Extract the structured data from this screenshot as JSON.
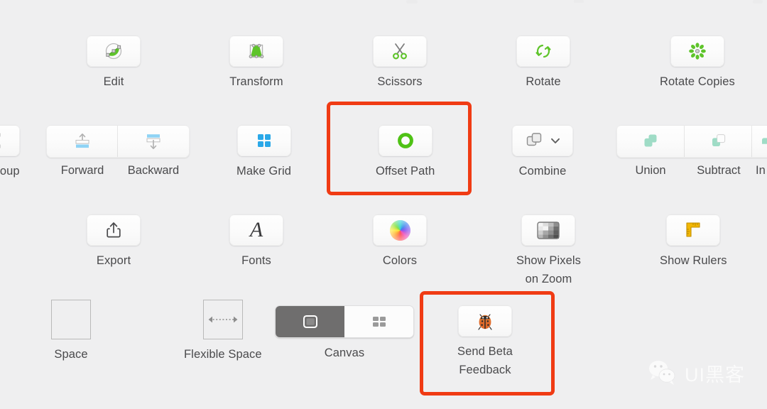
{
  "window": {
    "background_color": "#efeff0",
    "context": "macOS toolbar customization sheet"
  },
  "colors": {
    "accent_green": "#4fc215",
    "accent_blue": "#4db8f0",
    "accent_mint": "#9fdcc6",
    "accent_orange_highlight": "#f03b14",
    "label_text": "#4a4a4c",
    "tile_background": "#fbfbfb",
    "canvas_selected": "#6f6e6e",
    "ruler_yellow": "#f2b705"
  },
  "rows": {
    "row1": {
      "items": [
        {
          "label": "Edit",
          "icon": "edit-path-icon"
        },
        {
          "label": "Transform",
          "icon": "transform-icon"
        },
        {
          "label": "Scissors",
          "icon": "scissors-icon"
        },
        {
          "label": "Rotate",
          "icon": "rotate-icon"
        },
        {
          "label": "Rotate Copies",
          "icon": "rotate-copies-icon"
        }
      ]
    },
    "row2": {
      "group_clipped_label": "roup",
      "forward_backward": {
        "labels": [
          "Forward",
          "Backward"
        ],
        "icons": [
          "bring-forward-icon",
          "send-backward-icon"
        ]
      },
      "make_grid": {
        "label": "Make Grid",
        "icon": "make-grid-icon"
      },
      "offset_path": {
        "label": "Offset Path",
        "icon": "offset-path-icon",
        "highlighted": true
      },
      "combine": {
        "label": "Combine",
        "icon": "combine-icon",
        "has_dropdown": true
      },
      "boolean_ops": {
        "labels": [
          "Union",
          "Subtract",
          "In"
        ],
        "icons": [
          "union-icon",
          "subtract-icon",
          "intersect-icon"
        ]
      }
    },
    "row3": {
      "items": [
        {
          "label": "Export",
          "icon": "export-share-icon"
        },
        {
          "label": "Fonts",
          "icon": "fonts-icon"
        },
        {
          "label": "Colors",
          "icon": "colors-wheel-icon"
        },
        {
          "label": "Show Pixels\non Zoom",
          "icon": "show-pixels-icon"
        },
        {
          "label": "Show Rulers",
          "icon": "show-rulers-icon"
        }
      ]
    },
    "row4": {
      "space": {
        "label": "Space",
        "icon": "space-box-icon"
      },
      "flexible_space": {
        "label": "Flexible Space",
        "icon": "flexible-space-icon"
      },
      "canvas": {
        "label": "Canvas",
        "segments": [
          "single-canvas-icon",
          "multi-canvas-icon"
        ],
        "selected_index": 0
      },
      "send_beta_feedback": {
        "label": "Send Beta\nFeedback",
        "icon": "ladybug-icon",
        "highlighted": true
      }
    }
  },
  "highlights": [
    {
      "name": "offset-path-highlight",
      "target": "Offset Path"
    },
    {
      "name": "send-beta-feedback-highlight",
      "target": "Send Beta Feedback"
    }
  ],
  "watermark": {
    "text": "UI黑客",
    "icon": "wechat-icon"
  }
}
